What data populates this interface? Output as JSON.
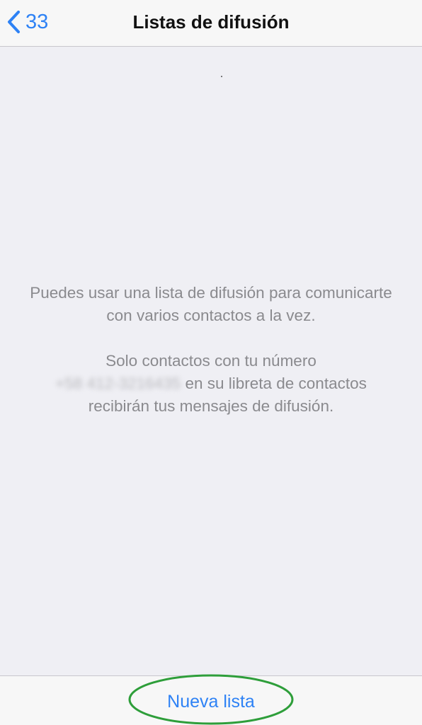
{
  "nav": {
    "back_count": "33",
    "title": "Listas de difusión"
  },
  "info": {
    "line_1": "Puedes usar una lista de difusión para comunicarte con varios contactos a la vez.",
    "line_2_prefix": "Solo contactos con tu número",
    "phone_number": "+58 412-3216435",
    "line_2_suffix": " en su libreta de contactos recibirán tus mensajes de difusión."
  },
  "toolbar": {
    "new_list_label": "Nueva lista"
  },
  "colors": {
    "accent": "#2e82f5",
    "highlight": "#2e9e3a"
  },
  "icons": {
    "back": "chevron-left-icon"
  }
}
